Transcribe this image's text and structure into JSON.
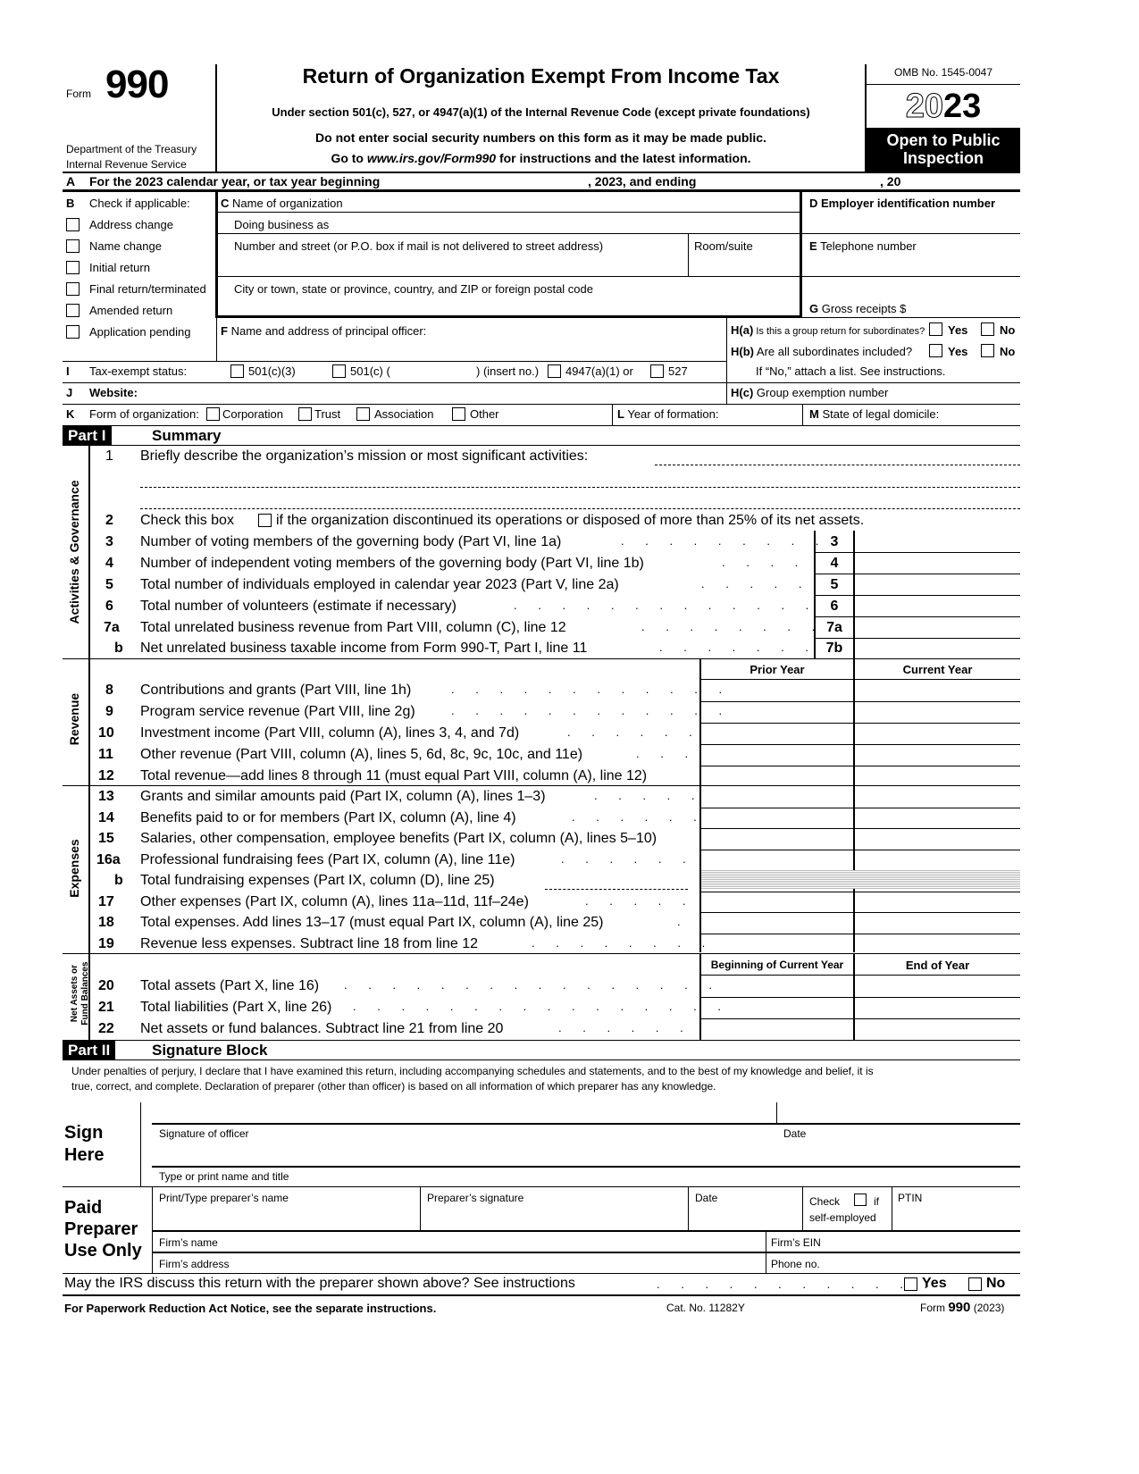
{
  "header": {
    "form_word": "Form",
    "form_number": "990",
    "department": "Department of the Treasury",
    "service": "Internal Revenue Service",
    "title": "Return of Organization Exempt From Income Tax",
    "subtitle": "Under section 501(c), 527, or 4947(a)(1) of the Internal Revenue Code (except private foundations)",
    "notice1": "Do not enter social security numbers on this form as it may be made public.",
    "notice2_prefix": "Go to ",
    "notice2_link": "www.irs.gov/Form990",
    "notice2_suffix": " for instructions and the latest information.",
    "omb": "OMB No. 1545-0047",
    "year_outline": "20",
    "year_bold": "23",
    "open_public_1": "Open to Public",
    "open_public_2": "Inspection"
  },
  "line_a": {
    "letter": "A",
    "text": "For the 2023 calendar year, or tax year beginning",
    "middle": ", 2023, and ending",
    "end": ", 20"
  },
  "section_b": {
    "letter": "B",
    "label": "Check if applicable:",
    "items": [
      {
        "label": "Address change",
        "checked": false
      },
      {
        "label": "Name change",
        "checked": false
      },
      {
        "label": "Initial return",
        "checked": false
      },
      {
        "label": "Final return/terminated",
        "checked": false
      },
      {
        "label": "Amended return",
        "checked": false
      },
      {
        "label": "Application pending",
        "checked": false
      }
    ]
  },
  "section_c": {
    "letter": "C",
    "name_label": "Name of organization",
    "dba_label": "Doing business as",
    "street_label": "Number and street (or P.O. box if mail is not delivered to street address)",
    "room_label": "Room/suite",
    "city_label": "City or town, state or province, country, and ZIP or foreign postal code",
    "name_value": "",
    "dba_value": "",
    "street_value": "",
    "room_value": "",
    "city_value": ""
  },
  "section_d": {
    "letter": "D",
    "label": "Employer identification number",
    "value": ""
  },
  "section_e": {
    "letter": "E",
    "label": "Telephone number",
    "value": ""
  },
  "section_g": {
    "letter": "G",
    "label": "Gross receipts $",
    "value": ""
  },
  "section_f": {
    "letter": "F",
    "label": "Name and address of principal officer:",
    "value": ""
  },
  "section_h": {
    "ha_code": "H(a)",
    "ha_text": "Is this a group return for subordinates?",
    "hb_code": "H(b)",
    "hb_text": "Are all subordinates included?",
    "hb_note": "If “No,” attach a list. See instructions.",
    "hc_code": "H(c)",
    "hc_text": "Group exemption number",
    "yes": "Yes",
    "no": "No"
  },
  "section_i": {
    "letter": "I",
    "label": "Tax-exempt status:",
    "opt1": "501(c)(3)",
    "opt2": "501(c) (",
    "opt2_suffix": ") (insert no.)",
    "opt3": "4947(a)(1) or",
    "opt4": "527"
  },
  "section_j": {
    "letter": "J",
    "label": "Website:",
    "value": ""
  },
  "section_k": {
    "letter": "K",
    "label": "Form of organization:",
    "options": [
      "Corporation",
      "Trust",
      "Association",
      "Other"
    ]
  },
  "section_l": {
    "letter": "L",
    "label": "Year of formation:"
  },
  "section_m": {
    "letter": "M",
    "label": "State of legal domicile:"
  },
  "part1": {
    "part_label": "Part I",
    "title": "Summary",
    "side_activities": "Activities & Governance",
    "side_revenue": "Revenue",
    "side_expenses": "Expenses",
    "side_net_1": "Net Assets or",
    "side_net_2": "Fund Balances",
    "line1_num": "1",
    "line1_text": "Briefly describe the organization’s mission or most significant activities:",
    "line2_num": "2",
    "line2_pre": "Check this box",
    "line2_post": "if the organization discontinued its operations or disposed of more than 25% of its net assets.",
    "gov_lines": [
      {
        "num": "3",
        "text": "Number of voting members of the governing body (Part VI, line 1a)",
        "box": "3",
        "value": ""
      },
      {
        "num": "4",
        "text": "Number of independent voting members of the governing body (Part VI, line 1b)",
        "box": "4",
        "value": ""
      },
      {
        "num": "5",
        "text": "Total number of individuals employed in calendar year 2023 (Part V, line 2a)",
        "box": "5",
        "value": ""
      },
      {
        "num": "6",
        "text": "Total number of volunteers (estimate if necessary)",
        "box": "6",
        "value": ""
      },
      {
        "num": "7a",
        "text": "Total unrelated business revenue from Part VIII, column (C), line 12",
        "box": "7a",
        "value": ""
      },
      {
        "num": "b",
        "text": "Net unrelated business taxable income from Form 990-T, Part I, line 11",
        "box": "7b",
        "value": ""
      }
    ],
    "col_prior": "Prior Year",
    "col_current": "Current Year",
    "revenue_lines": [
      {
        "num": "8",
        "text": "Contributions and grants (Part VIII, line 1h)"
      },
      {
        "num": "9",
        "text": "Program service revenue (Part VIII, line 2g)"
      },
      {
        "num": "10",
        "text": "Investment income (Part VIII, column (A), lines 3, 4, and 7d)"
      },
      {
        "num": "11",
        "text": "Other revenue (Part VIII, column (A), lines 5, 6d, 8c, 9c, 10c, and 11e)"
      },
      {
        "num": "12",
        "text": "Total revenue—add lines 8 through 11 (must equal Part VIII, column (A), line 12)"
      }
    ],
    "expense_lines": [
      {
        "num": "13",
        "text": "Grants and similar amounts paid (Part IX, column (A), lines 1–3)"
      },
      {
        "num": "14",
        "text": "Benefits paid to or for members (Part IX, column (A), line 4)"
      },
      {
        "num": "15",
        "text": "Salaries, other compensation, employee benefits (Part IX, column (A), lines 5–10)"
      },
      {
        "num": "16a",
        "text": "Professional fundraising fees (Part IX, column (A), line 11e)"
      },
      {
        "num": "b",
        "text": "Total fundraising expenses (Part IX, column (D), line 25)"
      },
      {
        "num": "17",
        "text": "Other expenses (Part IX, column (A), lines 11a–11d, 11f–24e)"
      },
      {
        "num": "18",
        "text": "Total expenses. Add lines 13–17 (must equal Part IX, column (A), line 25)"
      },
      {
        "num": "19",
        "text": "Revenue less expenses. Subtract line 18 from line 12"
      }
    ],
    "col_begin": "Beginning of Current Year",
    "col_end": "End of Year",
    "net_lines": [
      {
        "num": "20",
        "text": "Total assets (Part X, line 16)"
      },
      {
        "num": "21",
        "text": "Total liabilities (Part X, line 26)"
      },
      {
        "num": "22",
        "text": "Net assets or fund balances. Subtract line 21 from line 20"
      }
    ]
  },
  "part2": {
    "part_label": "Part II",
    "title": "Signature Block",
    "perjury_1": "Under penalties of perjury, I declare that I have examined this return, including accompanying schedules and statements, and to the best of my knowledge and belief, it is",
    "perjury_2": "true, correct, and complete. Declaration of preparer (other than officer) is based on all information of which preparer has any knowledge.",
    "sign_1": "Sign",
    "sign_2": "Here",
    "sig_officer": "Signature of officer",
    "date": "Date",
    "print_name": "Type or print name and title",
    "paid_1": "Paid",
    "paid_2": "Preparer",
    "paid_3": "Use Only",
    "prep_name": "Print/Type preparer’s name",
    "prep_sig": "Preparer’s signature",
    "prep_date": "Date",
    "check": "Check",
    "if": "if",
    "self_employed": "self-employed",
    "ptin": "PTIN",
    "firm_name": "Firm’s name",
    "firm_ein": "Firm’s EIN",
    "firm_address": "Firm’s address",
    "phone": "Phone no.",
    "discuss": "May the IRS discuss this return with the preparer shown above? See instructions",
    "yes": "Yes",
    "no": "No"
  },
  "footer": {
    "paperwork": "For Paperwork Reduction Act Notice, see the separate instructions.",
    "cat_no": "Cat. No. 11282Y",
    "form_word": "Form",
    "form_num": "990",
    "form_year": "(2023)"
  }
}
